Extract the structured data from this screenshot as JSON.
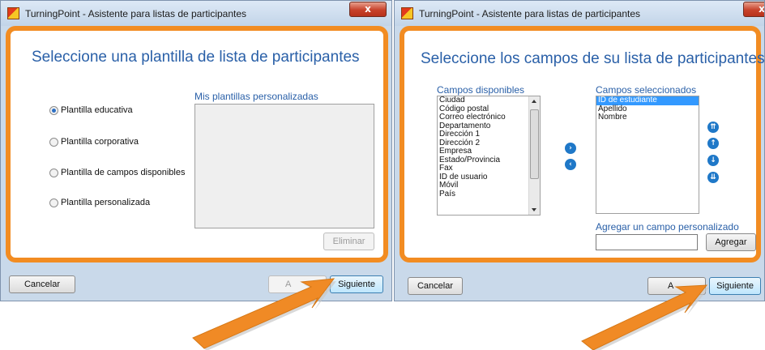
{
  "window_title": "TurningPoint - Asistente para listas de participantes",
  "close_symbol": "x",
  "accent_color": "#f28c22",
  "left": {
    "heading": "Seleccione una plantilla de lista de participantes",
    "options": [
      {
        "label": "Plantilla educativa",
        "checked": true
      },
      {
        "label": "Plantilla corporativa",
        "checked": false
      },
      {
        "label": "Plantilla de campos disponibles",
        "checked": false
      },
      {
        "label": "Plantilla personalizada",
        "checked": false
      }
    ],
    "custom_templates_label": "Mis plantillas personalizadas",
    "delete_button": "Eliminar",
    "cancel_button": "Cancelar",
    "back_button_partial": "A",
    "next_button": "Siguiente"
  },
  "right": {
    "heading": "Seleccione los campos de su lista de participantes",
    "available_label": "Campos disponibles",
    "available_fields": [
      "Ciudad",
      "Código postal",
      "Correo electrónico",
      "Departamento",
      "Dirección 1",
      "Dirección 2",
      "Empresa",
      "Estado/Provincia",
      "Fax",
      "ID de usuario",
      "Móvil",
      "País"
    ],
    "selected_label": "Campos seleccionados",
    "selected_fields": [
      "ID de estudiante",
      "Apellido",
      "Nombre"
    ],
    "custom_field_label": "Agregar un campo personalizado",
    "custom_field_value": "",
    "add_button": "Agregar",
    "cancel_button": "Cancelar",
    "back_button_partial": "A",
    "next_button": "Siguiente"
  }
}
